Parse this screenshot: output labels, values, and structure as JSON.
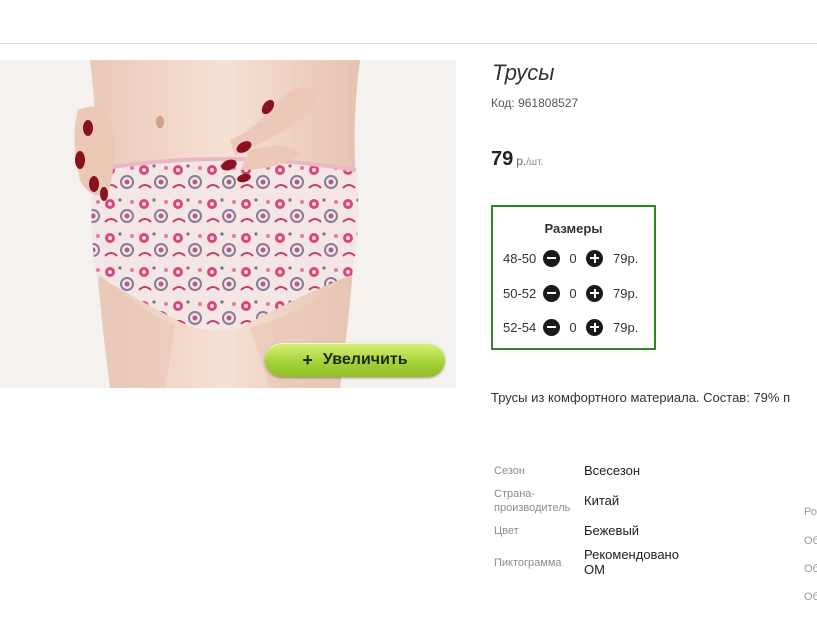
{
  "product": {
    "title": "Трусы",
    "code": "Код: 961808527",
    "price": {
      "value": "79",
      "unit": "р.",
      "per": "/шт."
    },
    "zoom_label": "Увеличить",
    "zoom_icon": "plus-icon"
  },
  "sizes": {
    "title": "Размеры",
    "rows": [
      {
        "range": "48-50",
        "qty": "0",
        "price": "79р."
      },
      {
        "range": "50-52",
        "qty": "0",
        "price": "79р."
      },
      {
        "range": "52-54",
        "qty": "0",
        "price": "79р."
      }
    ]
  },
  "description": "Трусы из комфортного материала. Состав: 79% п",
  "specs": [
    {
      "label": "Сезон",
      "value": "Всесезон"
    },
    {
      "label": "Страна-производитель",
      "label_line1": "Страна-",
      "label_line2": "производитель",
      "value": "Китай"
    },
    {
      "label": "Цвет",
      "value": "Бежевый"
    },
    {
      "label": "Пиктограмма",
      "value": "Рекомендовано ОМ",
      "value_line1": "Рекомендовано",
      "value_line2": "ОМ"
    }
  ],
  "edge_labels": [
    "Ро",
    "Об",
    "Об",
    "Об"
  ],
  "colors": {
    "accent_green": "#2a8a1f",
    "zoom_button": "#a5d23a"
  }
}
